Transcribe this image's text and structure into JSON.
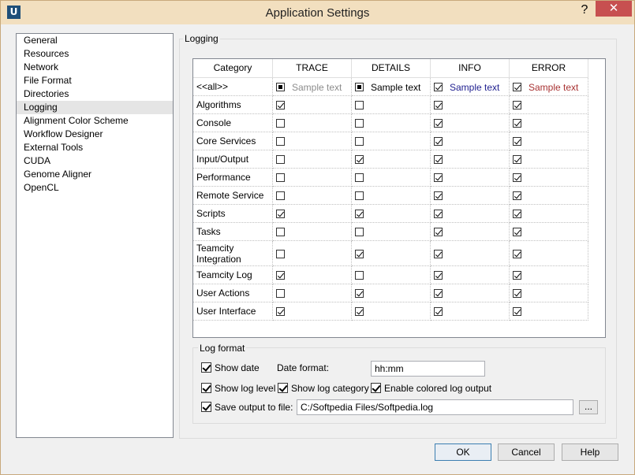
{
  "window": {
    "title": "Application Settings",
    "icon_letter": "U",
    "help_label": "?",
    "close_label": "✕"
  },
  "nav": {
    "items": [
      "General",
      "Resources",
      "Network",
      "File Format",
      "Directories",
      "Logging",
      "Alignment Color Scheme",
      "Workflow Designer",
      "External Tools",
      "CUDA",
      "Genome Aligner",
      "OpenCL"
    ],
    "active_index": 5
  },
  "logging": {
    "group_label": "Logging",
    "columns": [
      "Category",
      "TRACE",
      "DETAILS",
      "INFO",
      "ERROR"
    ],
    "all_row": {
      "label": "<<all>>",
      "states": [
        "partial",
        "partial",
        "checked",
        "checked"
      ],
      "sample_text": "Sample text",
      "sample_colors": [
        "#8c8c8c",
        "#000000",
        "#1f1f8f",
        "#a83232"
      ]
    },
    "rows": [
      {
        "label": "Algorithms",
        "states": [
          true,
          false,
          true,
          true
        ]
      },
      {
        "label": "Console",
        "states": [
          false,
          false,
          true,
          true
        ]
      },
      {
        "label": "Core Services",
        "states": [
          false,
          false,
          true,
          true
        ]
      },
      {
        "label": "Input/Output",
        "states": [
          false,
          true,
          true,
          true
        ]
      },
      {
        "label": "Performance",
        "states": [
          false,
          false,
          true,
          true
        ]
      },
      {
        "label": "Remote Service",
        "states": [
          false,
          false,
          true,
          true
        ]
      },
      {
        "label": "Scripts",
        "states": [
          true,
          true,
          true,
          true
        ]
      },
      {
        "label": "Tasks",
        "states": [
          false,
          false,
          true,
          true
        ]
      },
      {
        "label": "Teamcity Integration",
        "states": [
          false,
          true,
          true,
          true
        ]
      },
      {
        "label": "Teamcity Log",
        "states": [
          true,
          false,
          true,
          true
        ]
      },
      {
        "label": "User Actions",
        "states": [
          false,
          true,
          true,
          true
        ]
      },
      {
        "label": "User Interface",
        "states": [
          true,
          true,
          true,
          true
        ]
      }
    ]
  },
  "log_format": {
    "group_label": "Log format",
    "show_date": {
      "label": "Show date",
      "checked": true
    },
    "date_format_label": "Date format:",
    "date_format_value": "hh:mm",
    "show_log_level": {
      "label": "Show log level",
      "checked": true
    },
    "show_log_category": {
      "label": "Show log category",
      "checked": true
    },
    "enable_colored": {
      "label": "Enable colored log output",
      "checked": true
    },
    "save_output": {
      "label": "Save output to file:",
      "checked": true
    },
    "file_path": "C:/Softpedia Files/Softpedia.log",
    "browse_label": "..."
  },
  "buttons": {
    "ok": "OK",
    "cancel": "Cancel",
    "help": "Help"
  }
}
